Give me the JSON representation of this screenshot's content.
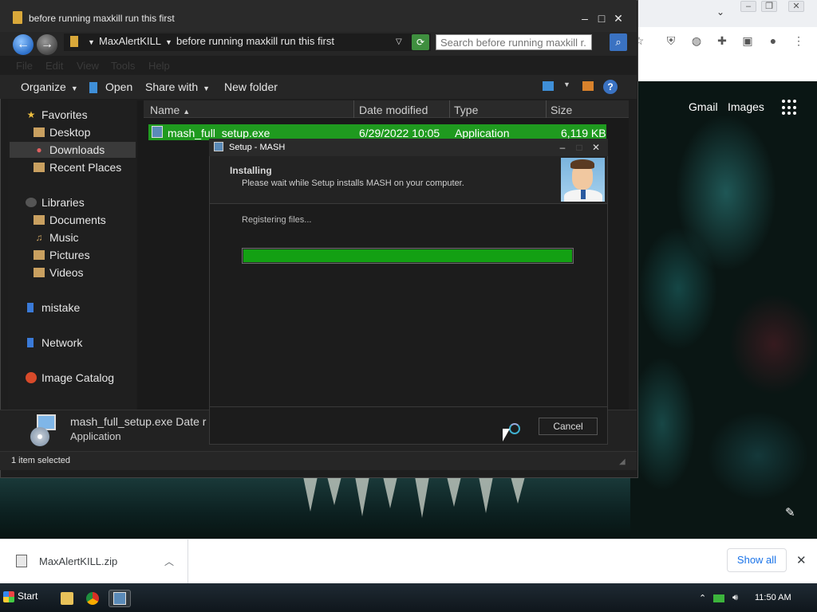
{
  "explorer": {
    "title": "before running maxkill run this first",
    "breadcrumb": [
      "MaxAlertKILL",
      "before running maxkill run this first"
    ],
    "search_placeholder": "Search before running maxkill r...",
    "menu": [
      "File",
      "Edit",
      "View",
      "Tools",
      "Help"
    ],
    "commands": {
      "organize": "Organize",
      "open": "Open",
      "share_with": "Share with",
      "new_folder": "New folder"
    },
    "nav": {
      "favorites": "Favorites",
      "desktop": "Desktop",
      "downloads": "Downloads",
      "recent": "Recent Places",
      "libraries": "Libraries",
      "documents": "Documents",
      "music": "Music",
      "pictures": "Pictures",
      "videos": "Videos",
      "mistake": "mistake",
      "network": "Network",
      "image_catalog": "Image Catalog"
    },
    "columns": {
      "name": "Name",
      "date": "Date modified",
      "type": "Type",
      "size": "Size"
    },
    "file": {
      "name": "mash_full_setup.exe",
      "date": "6/29/2022 10:05",
      "type": "Application",
      "size": "6,119 KB"
    },
    "details": {
      "name": "mash_full_setup.exe  Date r",
      "type": "Application"
    },
    "status": "1 item selected"
  },
  "setup": {
    "title": "Setup - MASH",
    "heading": "Installing",
    "subheading": "Please wait while Setup installs MASH on your computer.",
    "status": "Registering files...",
    "progress": 1.0,
    "cancel": "Cancel"
  },
  "browser": {
    "gmail": "Gmail",
    "images": "Images"
  },
  "downloads": {
    "file": "MaxAlertKILL.zip",
    "show_all": "Show all"
  },
  "taskbar": {
    "start": "Start",
    "clock": "11:50 AM"
  },
  "colors": {
    "selection_green": "#1f9a1f",
    "progress_green": "#13a013",
    "link_blue": "#1a73e8"
  }
}
